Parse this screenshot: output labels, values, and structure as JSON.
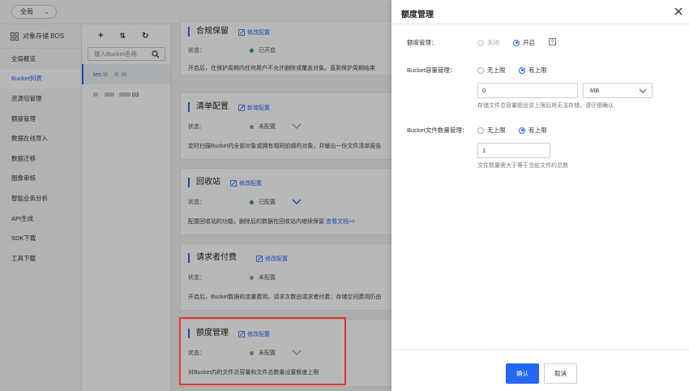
{
  "topbar": {
    "region": "全局"
  },
  "nav": {
    "title": "对象存储 BOS",
    "items": [
      {
        "label": "全局概览"
      },
      {
        "label": "Bucket列表"
      },
      {
        "label": "资源包管理"
      },
      {
        "label": "额度管理"
      },
      {
        "label": "数据在线导入"
      },
      {
        "label": "数据迁移"
      },
      {
        "label": "图像审核"
      },
      {
        "label": "智能业务分析"
      },
      {
        "label": "API生成"
      },
      {
        "label": "SDK下载"
      },
      {
        "label": "工具下载"
      }
    ]
  },
  "bucket_list": {
    "search_placeholder": "输入Bucket名称",
    "rows": [
      {
        "name_prefix": "tes"
      },
      {
        "name_suffix": "03"
      }
    ]
  },
  "cards": [
    {
      "title": "合规保留",
      "edit": "修改配置",
      "status_label": "状态：",
      "status": "已开启",
      "status_color": "#2da641",
      "desc": "开启后，在保护周期内任何用户不允许删除或覆盖对象。直到保护周期结束"
    },
    {
      "title": "清单配置",
      "edit": "新增配置",
      "status_label": "状态：",
      "status": "未配置",
      "status_color": "#999999",
      "desc": "定时扫描Bucket内全部对象或拥有相同前缀的对象，并输出一份文件清单报告"
    },
    {
      "title": "回收站",
      "edit": "修改配置",
      "status_label": "状态：",
      "status": "已配置",
      "status_color": "#2da641",
      "desc": "配置回收站的功能，删除后的数据在回收站内继续保留",
      "link": "查看文档>>"
    },
    {
      "title": "请求者付费",
      "edit": "修改配置",
      "status_label": "状态：",
      "status": "未配置",
      "status_color": "#999999",
      "desc": "开启后，Bucket数据的流量费用，请求次数由请求者付费；存储空间费用仍由"
    },
    {
      "title": "额度管理",
      "edit": "修改配置",
      "status_label": "状态：",
      "status": "未配置",
      "status_color": "#999999",
      "desc": "对Bucket内的文件总容量和文件总数量设置额度上限"
    }
  ],
  "drawer": {
    "title": "额度管理",
    "quota_label": "额度管理：",
    "quota_off": "关闭",
    "quota_on": "开启",
    "help": "?",
    "capacity_label": "Bucket容量管理：",
    "unlimited": "无上限",
    "limited": "有上限",
    "capacity_value": "0",
    "capacity_unit": "MB",
    "capacity_hint": "存储文件总容量超出该上限后将无法存储，请仔细确认",
    "count_label": "Bucket文件数量管理：",
    "count_value": "1",
    "count_hint": "文件数量需大于等于当前文件的总数",
    "confirm": "确认",
    "cancel": "取消"
  }
}
